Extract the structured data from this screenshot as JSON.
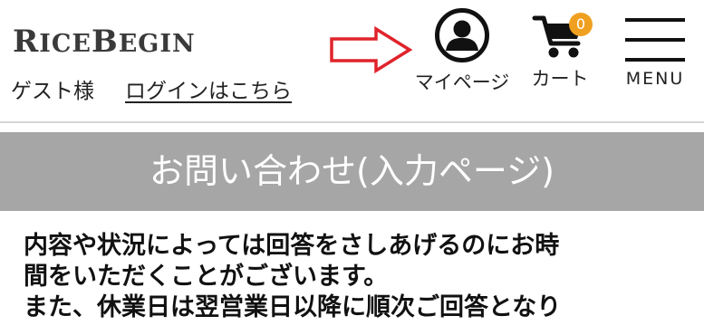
{
  "header": {
    "logo_text": "RICEBEGIN",
    "guest_label": "ゲスト様",
    "login_link": "ログインはこちら",
    "mypage_label": "マイページ",
    "cart_label": "カート",
    "cart_count": "0",
    "menu_label": "MENU"
  },
  "page": {
    "title": "お問い合わせ(入力ページ)",
    "body_lines": [
      "内容や状況によっては回答をさしあげるのにお時",
      "間をいただくことがございます。",
      "また、休業日は翌営業日以降に順次ご回答となり"
    ]
  },
  "colors": {
    "title_bar_bg": "#a6a6a6",
    "arrow": "#e0232b",
    "badge": "#f0a020"
  },
  "icons": [
    "account-circle-icon",
    "shopping-cart-icon",
    "hamburger-menu-icon",
    "right-arrow-icon"
  ]
}
